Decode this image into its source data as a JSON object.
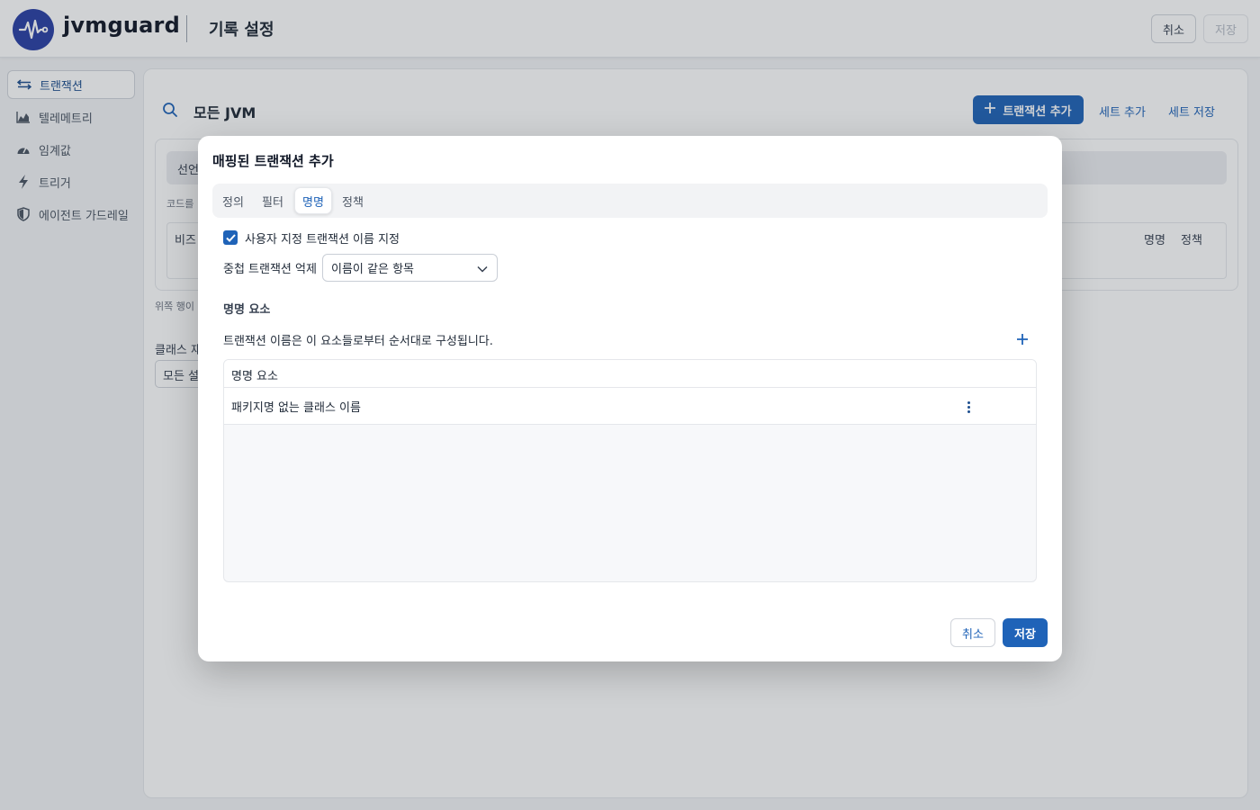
{
  "app": {
    "brand": "jvmguard",
    "page_title": "기록 설정",
    "cancel_label": "취소",
    "save_label": "저장"
  },
  "sidebar": {
    "items": [
      {
        "label": "트랜잭션",
        "icon": "transactions-icon",
        "active": true
      },
      {
        "label": "텔레메트리",
        "icon": "chart-icon",
        "active": false
      },
      {
        "label": "임계값",
        "icon": "gauge-icon",
        "active": false
      },
      {
        "label": "트리거",
        "icon": "lightning-icon",
        "active": false
      },
      {
        "label": "에이전트 가드레일",
        "icon": "shield-icon",
        "active": false
      }
    ]
  },
  "main": {
    "heading": "모든 JVM",
    "add_transaction_label": "트랜잭션 추가",
    "add_set_label": "세트 추가",
    "save_set_label": "세트 저장",
    "declare_text": "선언",
    "code_hint": "코드를",
    "table_headers": [
      "비즈",
      "명명",
      "정책"
    ],
    "below_hint": "위쪽 행이 우",
    "class_label": "클래스 재",
    "class_select_value": "모든 설"
  },
  "modal": {
    "title": "매핑된 트랜잭션 추가",
    "tabs": [
      "정의",
      "필터",
      "명명",
      "정책"
    ],
    "active_tab": "명명",
    "custom_name_checkbox_label": "사용자 지정 트랜잭션 이름 지정",
    "custom_name_checked": true,
    "suppress_label": "중첩 트랜잭션 억제",
    "suppress_value": "이름이 같은 항목",
    "section_title": "명명 요소",
    "section_desc": "트랜잭션 이름은 이 요소들로부터 순서대로 구성됩니다.",
    "grid_header": "명명 요소",
    "rows": [
      "패키지명 없는 클래스 이름"
    ],
    "cancel_label": "취소",
    "save_label": "저장"
  },
  "colors": {
    "primary": "#1f63b8",
    "brand": "#2a3fa5",
    "overlay": "rgba(40,48,60,0.22)"
  }
}
